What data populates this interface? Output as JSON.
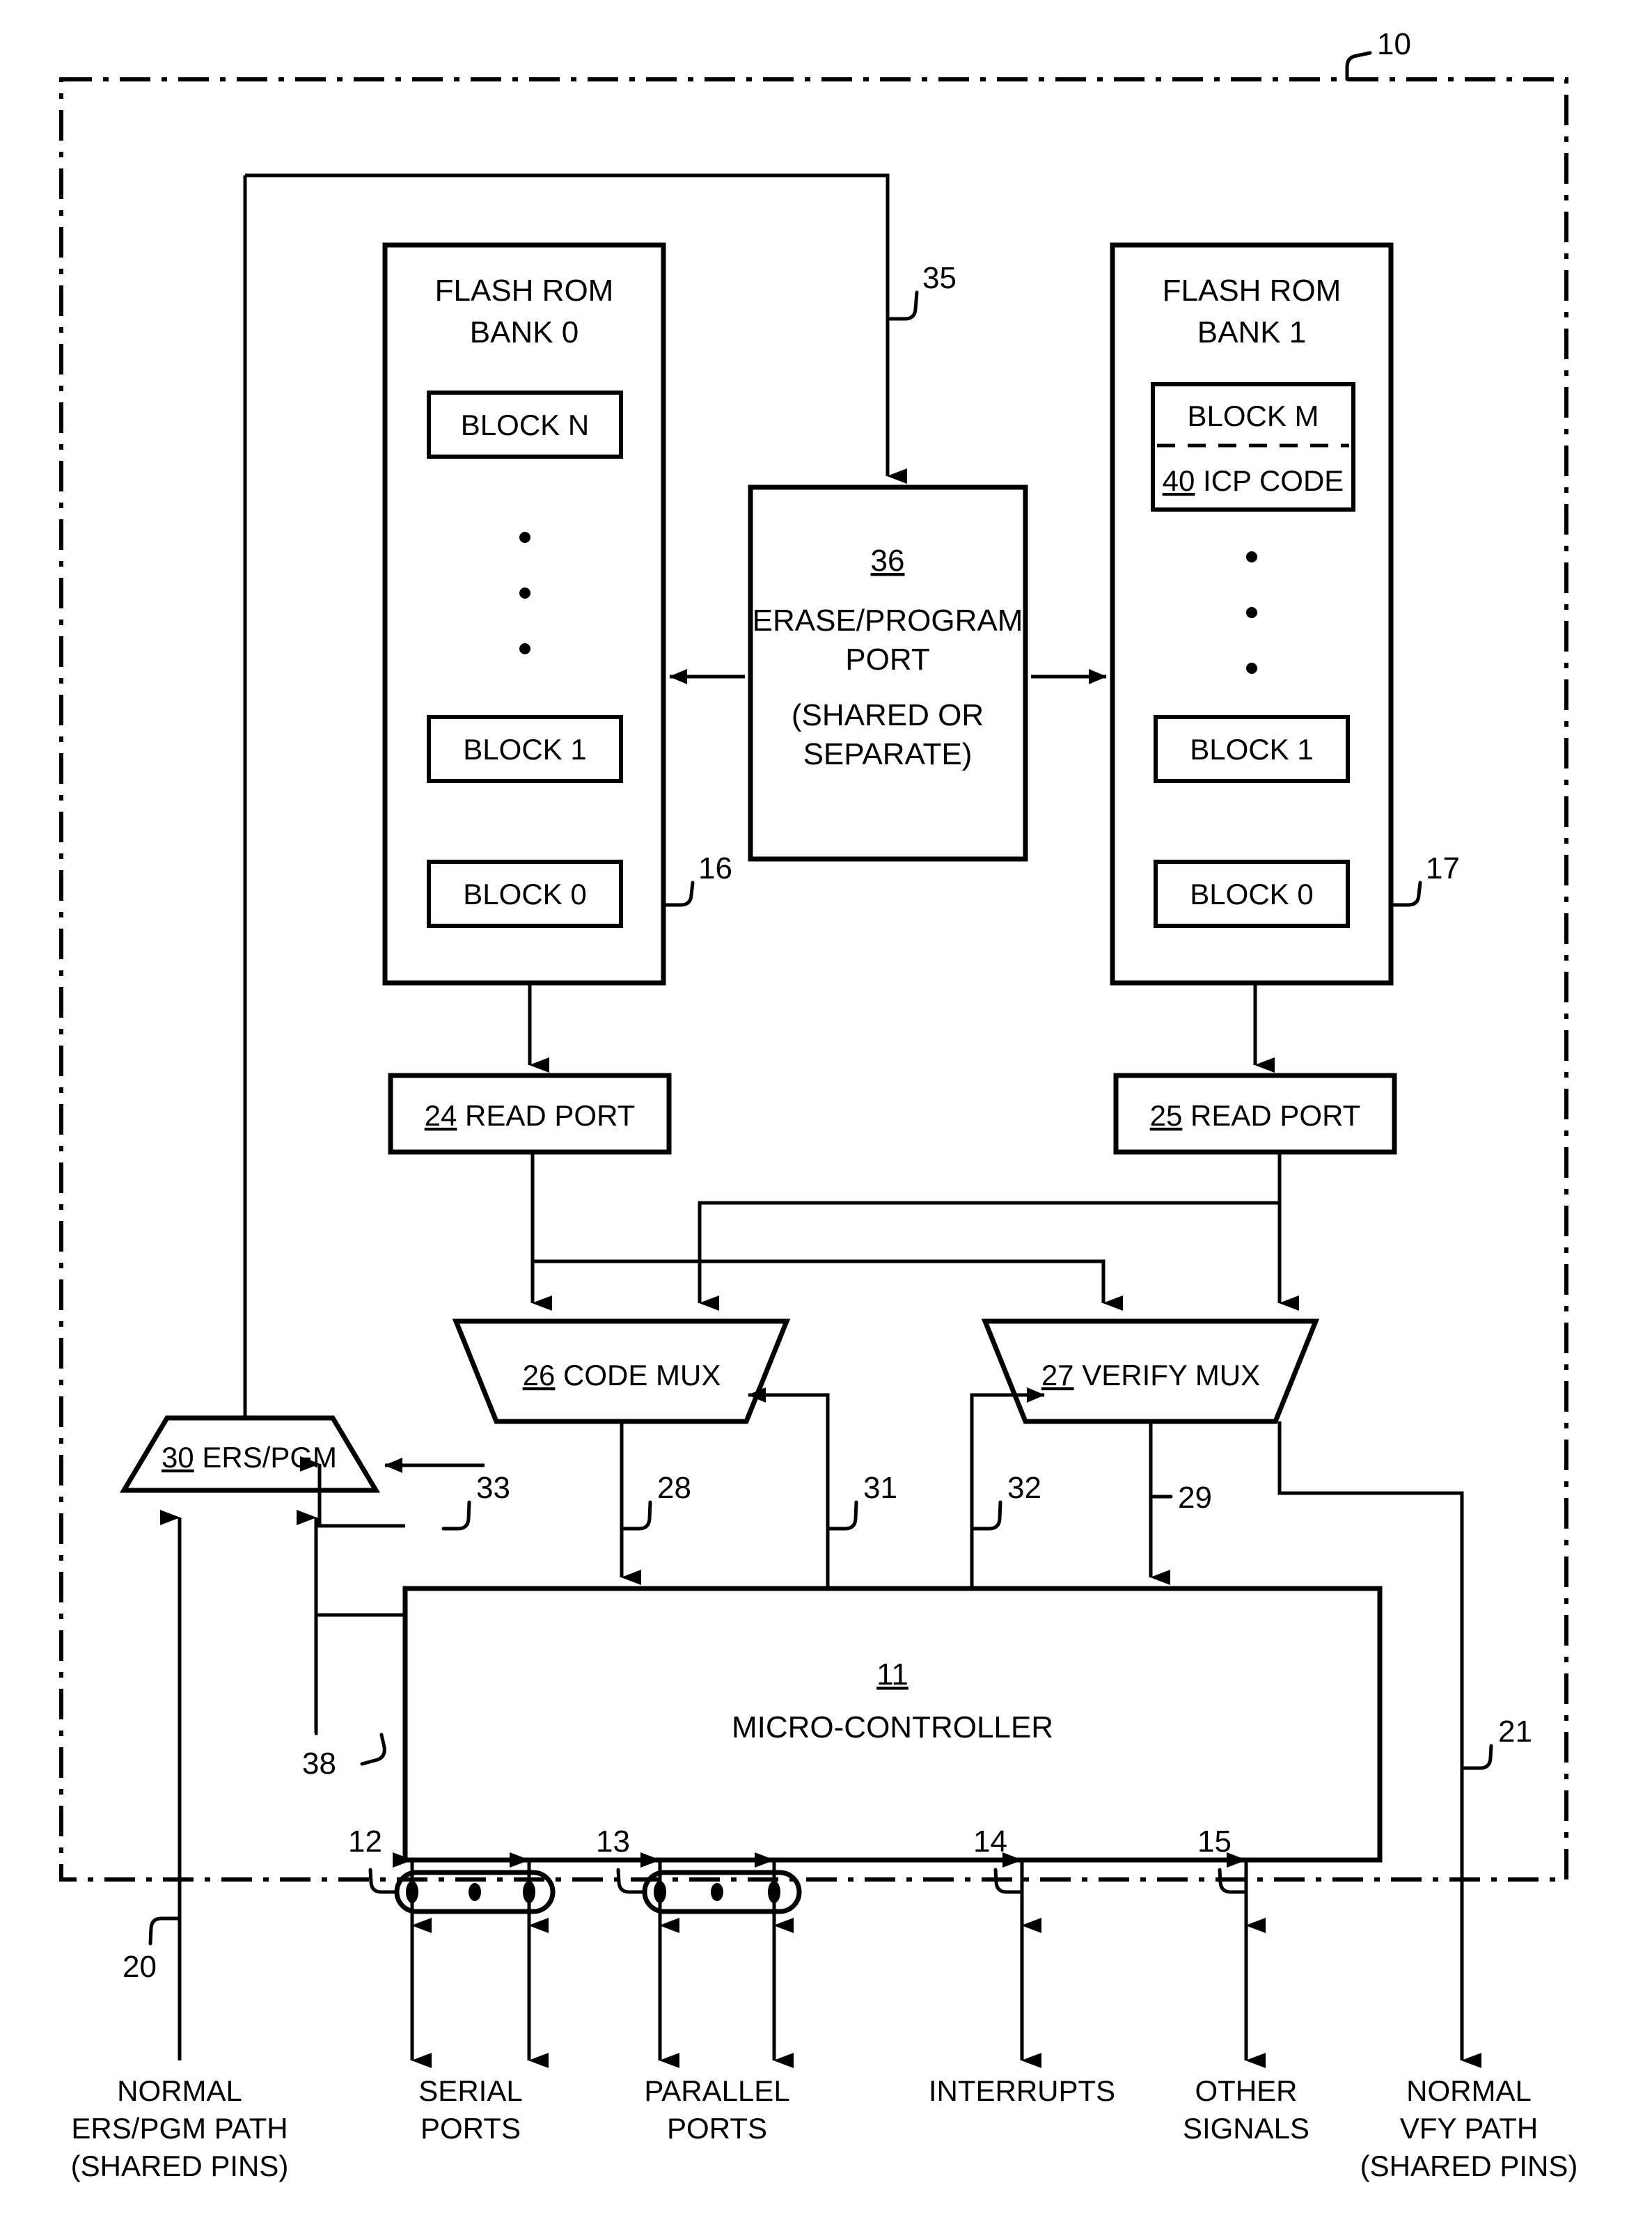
{
  "figure": {
    "outer_ref": "10",
    "banks": [
      {
        "title_line1": "FLASH ROM",
        "title_line2": "BANK 0",
        "ref": "16",
        "blocks": [
          "BLOCK N",
          "BLOCK 1",
          "BLOCK 0"
        ],
        "ellipsis": "•"
      },
      {
        "title_line1": "FLASH ROM",
        "title_line2": "BANK 1",
        "ref": "17",
        "blocks": [
          "BLOCK M",
          "BLOCK 1",
          "BLOCK 0"
        ],
        "icp_ref": "40",
        "icp_label": "ICP CODE",
        "ellipsis": "•"
      }
    ],
    "erase_program_port": {
      "ref": "36",
      "lines": [
        "ERASE/PROGRAM",
        "PORT",
        "(SHARED OR",
        "SEPARATE)"
      ],
      "input_ref": "35"
    },
    "read_ports": [
      {
        "ref": "24",
        "label": "READ PORT"
      },
      {
        "ref": "25",
        "label": "READ PORT"
      }
    ],
    "muxes": [
      {
        "ref": "26",
        "label": "CODE MUX"
      },
      {
        "ref": "27",
        "label": "VERIFY MUX"
      }
    ],
    "ers_pgm": {
      "ref": "30",
      "label": "ERS/PGM"
    },
    "microcontroller": {
      "ref": "11",
      "label": "MICRO-CONTROLLER"
    },
    "bus_refs": {
      "code_mux_out": "28",
      "verify_mux_out": "29",
      "code_mux_ctrl": "31",
      "verify_mux_ctrl": "32",
      "ers_pgm_ctrl": "33",
      "ers_pgm_data": "38",
      "normal_ers_pgm_path": "20",
      "normal_vfy_path": "21",
      "serial_ports": "12",
      "parallel_ports": "13",
      "interrupts": "14",
      "other_signals": "15"
    },
    "bottom_labels": [
      {
        "id": "normal-ers-pgm-path",
        "lines": [
          "NORMAL",
          "ERS/PGM PATH",
          "(SHARED PINS)"
        ]
      },
      {
        "id": "serial-ports",
        "lines": [
          "SERIAL",
          "PORTS"
        ]
      },
      {
        "id": "parallel-ports",
        "lines": [
          "PARALLEL",
          "PORTS"
        ]
      },
      {
        "id": "interrupts",
        "lines": [
          "INTERRUPTS"
        ]
      },
      {
        "id": "other-signals",
        "lines": [
          "OTHER",
          "SIGNALS"
        ]
      },
      {
        "id": "normal-vfy-path",
        "lines": [
          "NORMAL",
          "VFY PATH",
          "(SHARED PINS)"
        ]
      }
    ],
    "colors": {
      "line": "#000000",
      "background": "#ffffff"
    }
  }
}
